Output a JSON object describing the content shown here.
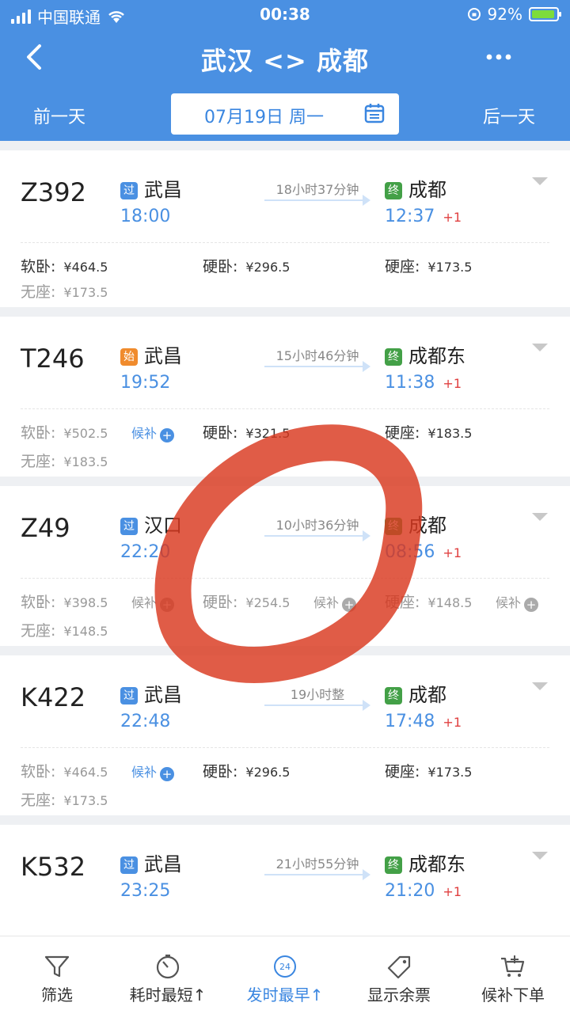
{
  "status_bar": {
    "carrier": "中国联通",
    "time": "00:38",
    "battery": "92%"
  },
  "header": {
    "title": "武汉 <> 成都"
  },
  "date_bar": {
    "prev": "前一天",
    "date": "07月19日 周一",
    "next": "后一天"
  },
  "trains": [
    {
      "no": "Z392",
      "from_tag": "过",
      "from": "武昌",
      "dep": "18:00",
      "duration": "18小时37分钟",
      "to_tag": "终",
      "to": "成都",
      "arr": "12:37",
      "plus": "+1",
      "seats": [
        {
          "name": "软卧:",
          "price": "¥464.5"
        },
        {
          "name": "硬卧:",
          "price": "¥296.5"
        },
        {
          "name": "硬座:",
          "price": "¥173.5"
        },
        {
          "name": "无座:",
          "price": "¥173.5"
        }
      ]
    },
    {
      "no": "T246",
      "from_tag": "始",
      "from": "武昌",
      "dep": "19:52",
      "duration": "15小时46分钟",
      "to_tag": "终",
      "to": "成都东",
      "arr": "11:38",
      "plus": "+1",
      "seats": [
        {
          "name": "软卧:",
          "price": "¥502.5",
          "houbu": "候补"
        },
        {
          "name": "硬卧:",
          "price": "¥321.5"
        },
        {
          "name": "硬座:",
          "price": "¥183.5"
        },
        {
          "name": "无座:",
          "price": "¥183.5"
        }
      ]
    },
    {
      "no": "Z49",
      "from_tag": "过",
      "from": "汉口",
      "dep": "22:20",
      "duration": "10小时36分钟",
      "to_tag": "终",
      "to": "成都",
      "arr": "08:56",
      "plus": "+1",
      "seats": [
        {
          "name": "软卧:",
          "price": "¥398.5",
          "houbu": "候补"
        },
        {
          "name": "硬卧:",
          "price": "¥254.5",
          "houbu": "候补"
        },
        {
          "name": "硬座:",
          "price": "¥148.5",
          "houbu": "候补"
        },
        {
          "name": "无座:",
          "price": "¥148.5"
        }
      ]
    },
    {
      "no": "K422",
      "from_tag": "过",
      "from": "武昌",
      "dep": "22:48",
      "duration": "19小时整",
      "to_tag": "终",
      "to": "成都",
      "arr": "17:48",
      "plus": "+1",
      "seats": [
        {
          "name": "软卧:",
          "price": "¥464.5",
          "houbu": "候补"
        },
        {
          "name": "硬卧:",
          "price": "¥296.5"
        },
        {
          "name": "硬座:",
          "price": "¥173.5"
        },
        {
          "name": "无座:",
          "price": "¥173.5"
        }
      ]
    },
    {
      "no": "K532",
      "from_tag": "过",
      "from": "武昌",
      "dep": "23:25",
      "duration": "21小时55分钟",
      "to_tag": "终",
      "to": "成都东",
      "arr": "21:20",
      "plus": "+1"
    }
  ],
  "bottom_tabs": [
    {
      "label": "筛选",
      "icon": "filter-icon"
    },
    {
      "label": "耗时最短↑",
      "icon": "stopwatch-icon"
    },
    {
      "label": "发时最早↑",
      "icon": "clock-24-icon",
      "active": true
    },
    {
      "label": "显示余票",
      "icon": "ticket-tag-icon"
    },
    {
      "label": "候补下单",
      "icon": "cart-plus-icon"
    }
  ],
  "colors": {
    "brand": "#4a90e2",
    "accent_red": "#e04040",
    "annotation": "#d9381e"
  }
}
